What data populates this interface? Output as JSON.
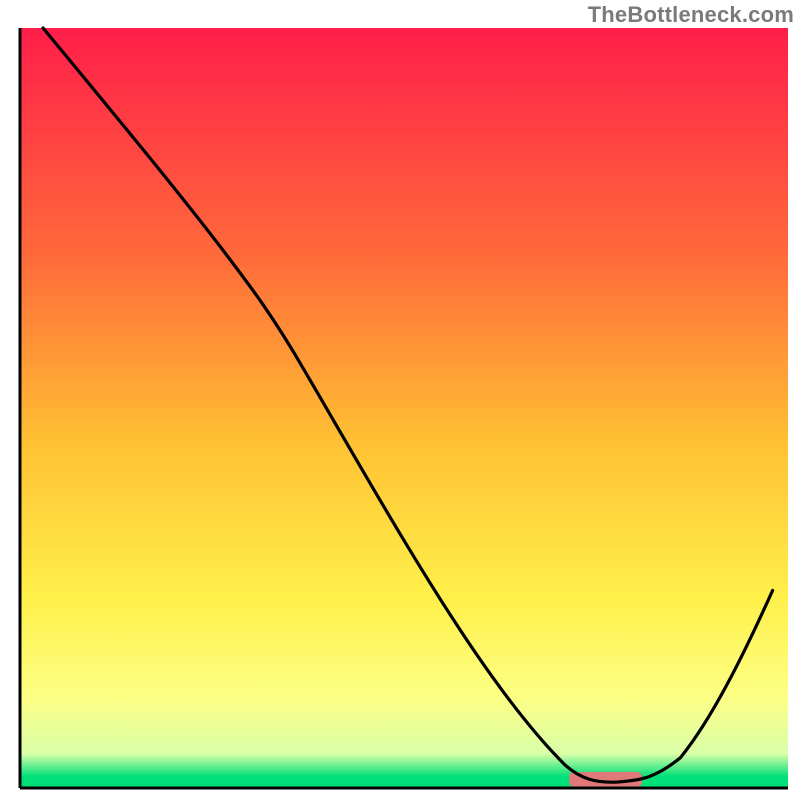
{
  "watermark": "TheBottleneck.com",
  "chart_data": {
    "type": "line",
    "title": "",
    "xlabel": "",
    "ylabel": "",
    "xlim": [
      0,
      100
    ],
    "ylim": [
      0,
      100
    ],
    "legend": false,
    "grid": false,
    "background": {
      "type": "vertical-gradient",
      "stops": [
        {
          "pos": 0.0,
          "color": "#ff1e4a"
        },
        {
          "pos": 0.3,
          "color": "#ff6a3a"
        },
        {
          "pos": 0.55,
          "color": "#ffc233"
        },
        {
          "pos": 0.75,
          "color": "#fff04a"
        },
        {
          "pos": 0.88,
          "color": "#fdff84"
        },
        {
          "pos": 0.955,
          "color": "#d9ffa8"
        },
        {
          "pos": 0.985,
          "color": "#00e079"
        },
        {
          "pos": 1.0,
          "color": "#00e079"
        }
      ]
    },
    "series": [
      {
        "name": "curve",
        "color": "#000000",
        "width": 3.2,
        "bezier": {
          "start": [
            3,
            100
          ],
          "segments": [
            {
              "c1": [
                12,
                89
              ],
              "c2": [
                21,
                78
              ],
              "end": [
                27,
                70
              ]
            },
            {
              "c1": [
                30,
                66
              ],
              "c2": [
                33,
                62
              ],
              "end": [
                37,
                55
              ]
            },
            {
              "c1": [
                48,
                36
              ],
              "c2": [
                60,
                14
              ],
              "end": [
                71,
                3
              ]
            },
            {
              "c1": [
                73,
                1.2
              ],
              "c2": [
                75,
                0.6
              ],
              "end": [
                78,
                0.8
              ]
            },
            {
              "c1": [
                81,
                1.0
              ],
              "c2": [
                83,
                1.5
              ],
              "end": [
                86,
                4
              ]
            },
            {
              "c1": [
                90,
                9
              ],
              "c2": [
                94,
                17
              ],
              "end": [
                98,
                26
              ]
            }
          ]
        }
      }
    ],
    "highlight_bar": {
      "x_start": 71.5,
      "x_end": 81,
      "y": 0,
      "color": "#e07a78",
      "thickness_pct": 1.2
    },
    "axes_color": "#000000",
    "axes_ticks": []
  }
}
